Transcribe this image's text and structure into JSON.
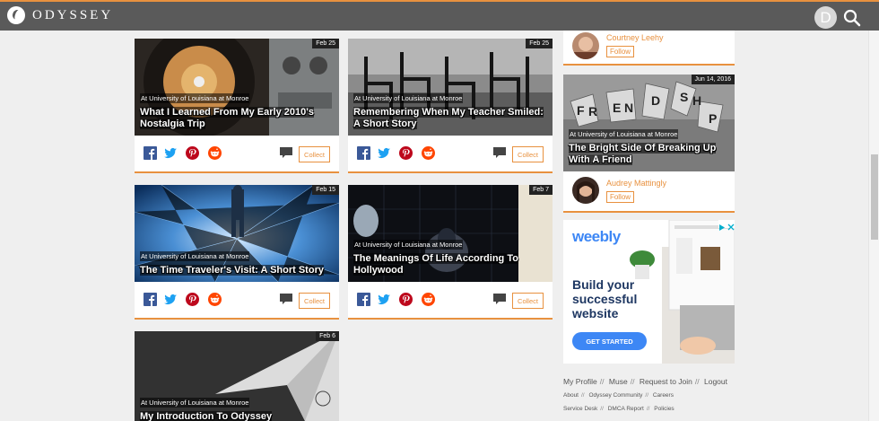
{
  "header": {
    "brand": "ODYSSEY",
    "avatar_letter": "D"
  },
  "articles": [
    {
      "date": "Feb 25",
      "location": "At University of Louisiana at Monroe",
      "title": "What I Learned From My Early 2010's Nostalgia Trip",
      "collect": "Collect"
    },
    {
      "date": "Feb 25",
      "location": "At University of Louisiana at Monroe",
      "title": "Remembering When My Teacher Smiled: A Short Story",
      "collect": "Collect"
    },
    {
      "date": "Feb 15",
      "location": "At University of Louisiana at Monroe",
      "title": "The Time Traveler's Visit: A Short Story",
      "collect": "Collect"
    },
    {
      "date": "Feb 7",
      "location": "At University of Louisiana at Monroe",
      "title": "The Meanings Of Life According To Hollywood",
      "collect": "Collect"
    },
    {
      "date": "Feb 6",
      "location": "At University of Louisiana at Monroe",
      "title": "My Introduction To Odyssey"
    }
  ],
  "sidebar": {
    "author_top": {
      "name": "Courtney Leehy",
      "follow": "Follow"
    },
    "feature": {
      "date": "Jun 14, 2016",
      "location": "At University of Louisiana at Monroe",
      "title": "The Bright Side Of Breaking Up With A Friend",
      "author": "Audrey Mattingly",
      "follow": "Follow"
    }
  },
  "ad": {
    "brand": "weebly",
    "headline": "Build your successful website",
    "cta": "GET STARTED"
  },
  "footer": {
    "row1": [
      "My Profile",
      "Muse",
      "Request to Join",
      "Logout"
    ],
    "row2": [
      "About",
      "Odyssey Community",
      "Careers"
    ],
    "row3": [
      "Service Desk",
      "DMCA Report",
      "Policies"
    ]
  },
  "colors": {
    "accent": "#e8913f",
    "topbar": "#5a5a5a",
    "facebook": "#3b5998",
    "twitter": "#1da1f2",
    "pinterest": "#bd081c",
    "reddit": "#ff4500"
  }
}
